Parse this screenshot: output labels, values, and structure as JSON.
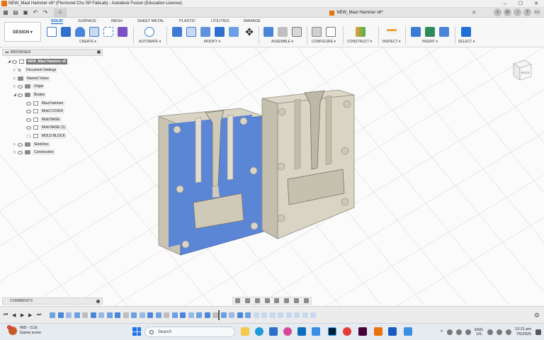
{
  "window": {
    "title": "NEW_Maul Hammer v6* (Flormond Chu SP FabLab) - Autodesk Fusion (Education License)",
    "controls": [
      "–",
      "☐",
      "✕"
    ]
  },
  "tabbar": {
    "doc_tab": "NEW_Maul Hammer v6*",
    "user_initials": "FC"
  },
  "toolbar": {
    "workspace": "DESIGN ▾",
    "tabs": [
      {
        "label": "SOLID",
        "active": true
      },
      {
        "label": "SURFACE",
        "active": false
      },
      {
        "label": "MESH",
        "active": false
      },
      {
        "label": "SHEET METAL",
        "active": false
      },
      {
        "label": "PLASTIC",
        "active": false
      },
      {
        "label": "UTILITIES",
        "active": false
      },
      {
        "label": "MANAGE",
        "active": false
      }
    ],
    "groups": {
      "create": "CREATE ▾",
      "automate": "AUTOMATE ▾",
      "modify": "MODIFY ▾",
      "assemble": "ASSEMBLE ▾",
      "configure": "CONFIGURE ▾",
      "construct": "CONSTRUCT ▾",
      "inspect": "INSPECT ▾",
      "insert": "INSERT ▾",
      "select": "SELECT ▾"
    }
  },
  "browser": {
    "title": "BROWSER",
    "root": "NEW_Maul Hammer v6",
    "items": [
      {
        "label": "Document Settings",
        "icon": "gear-icon"
      },
      {
        "label": "Named Views",
        "icon": "folder-icon"
      },
      {
        "label": "Origin",
        "icon": "folder-icon"
      },
      {
        "label": "Bodies",
        "icon": "folder-icon"
      }
    ],
    "bodies": [
      "Maul hammer",
      "Mold COVER",
      "Mold BASE",
      "Mold BASE (1)",
      "MOLD BLOCK"
    ],
    "after": [
      {
        "label": "Sketches",
        "icon": "folder-icon"
      },
      {
        "label": "Construction",
        "icon": "folder-icon"
      }
    ]
  },
  "viewcube": {
    "face": "BACK"
  },
  "comments": {
    "title": "COMMENTS"
  },
  "colors": {
    "accent": "#0066cc",
    "selected_face": "#5b86d6",
    "mold_body": "#d8d3c3",
    "fusion_orange": "#e8730c"
  },
  "taskbar": {
    "weather_title": "IND - CLE",
    "weather_sub": "Game score",
    "notif_count": "1",
    "search_placeholder": "Search",
    "lang_top": "ENG",
    "lang_bottom": "US",
    "time": "12:21 pm",
    "date": "7/5/2025"
  }
}
